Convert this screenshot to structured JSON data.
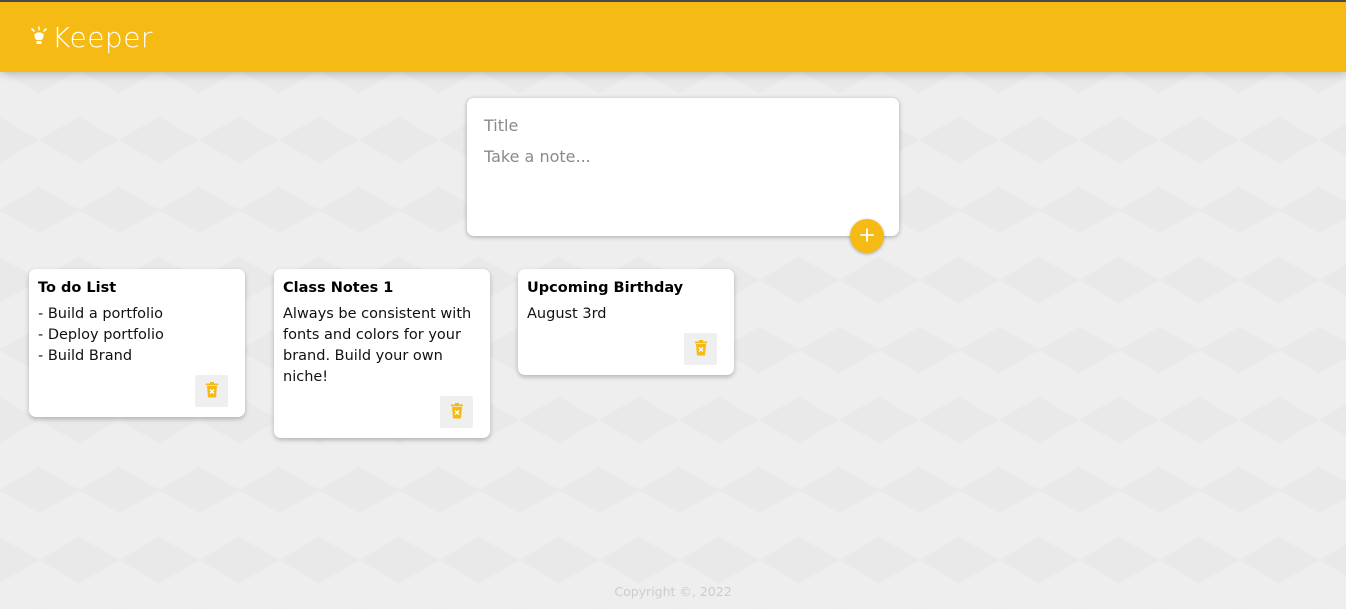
{
  "header": {
    "title": "Keeper",
    "logo_icon": "lightbulb-icon"
  },
  "create_note": {
    "title_placeholder": "Title",
    "content_placeholder": "Take a note...",
    "add_icon": "plus-icon"
  },
  "notes": [
    {
      "title": "To do List",
      "content": "- Build a portfolio\n- Deploy portfolio\n- Build Brand",
      "delete_icon": "trash-icon"
    },
    {
      "title": "Class Notes 1",
      "content": "Always be consistent with fonts and colors for your brand. Build your own niche!",
      "delete_icon": "trash-icon"
    },
    {
      "title": "Upcoming Birthday",
      "content": "August 3rd",
      "delete_icon": "trash-icon"
    }
  ],
  "footer": {
    "copyright": "Copyright ©, 2022"
  },
  "colors": {
    "accent": "#f5ba13",
    "background": "#eeeeee",
    "card": "#ffffff",
    "footer_text": "#cccccc"
  }
}
